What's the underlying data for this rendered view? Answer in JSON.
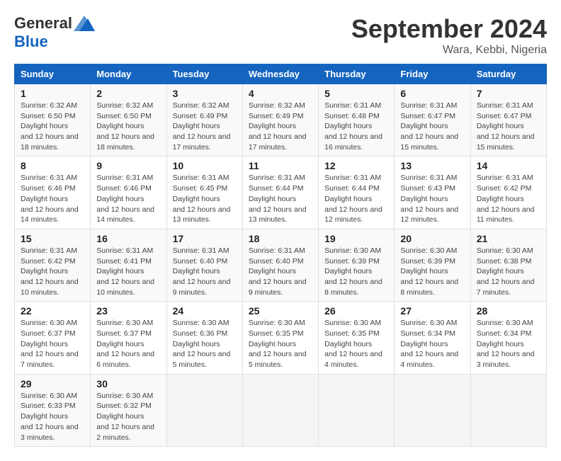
{
  "logo": {
    "general": "General",
    "blue": "Blue"
  },
  "title": {
    "month": "September 2024",
    "location": "Wara, Kebbi, Nigeria"
  },
  "columns": [
    "Sunday",
    "Monday",
    "Tuesday",
    "Wednesday",
    "Thursday",
    "Friday",
    "Saturday"
  ],
  "weeks": [
    [
      {
        "day": "1",
        "sunrise": "6:32 AM",
        "sunset": "6:50 PM",
        "daylight": "12 hours and 18 minutes."
      },
      {
        "day": "2",
        "sunrise": "6:32 AM",
        "sunset": "6:50 PM",
        "daylight": "12 hours and 18 minutes."
      },
      {
        "day": "3",
        "sunrise": "6:32 AM",
        "sunset": "6:49 PM",
        "daylight": "12 hours and 17 minutes."
      },
      {
        "day": "4",
        "sunrise": "6:32 AM",
        "sunset": "6:49 PM",
        "daylight": "12 hours and 17 minutes."
      },
      {
        "day": "5",
        "sunrise": "6:31 AM",
        "sunset": "6:48 PM",
        "daylight": "12 hours and 16 minutes."
      },
      {
        "day": "6",
        "sunrise": "6:31 AM",
        "sunset": "6:47 PM",
        "daylight": "12 hours and 15 minutes."
      },
      {
        "day": "7",
        "sunrise": "6:31 AM",
        "sunset": "6:47 PM",
        "daylight": "12 hours and 15 minutes."
      }
    ],
    [
      {
        "day": "8",
        "sunrise": "6:31 AM",
        "sunset": "6:46 PM",
        "daylight": "12 hours and 14 minutes."
      },
      {
        "day": "9",
        "sunrise": "6:31 AM",
        "sunset": "6:46 PM",
        "daylight": "12 hours and 14 minutes."
      },
      {
        "day": "10",
        "sunrise": "6:31 AM",
        "sunset": "6:45 PM",
        "daylight": "12 hours and 13 minutes."
      },
      {
        "day": "11",
        "sunrise": "6:31 AM",
        "sunset": "6:44 PM",
        "daylight": "12 hours and 13 minutes."
      },
      {
        "day": "12",
        "sunrise": "6:31 AM",
        "sunset": "6:44 PM",
        "daylight": "12 hours and 12 minutes."
      },
      {
        "day": "13",
        "sunrise": "6:31 AM",
        "sunset": "6:43 PM",
        "daylight": "12 hours and 12 minutes."
      },
      {
        "day": "14",
        "sunrise": "6:31 AM",
        "sunset": "6:42 PM",
        "daylight": "12 hours and 11 minutes."
      }
    ],
    [
      {
        "day": "15",
        "sunrise": "6:31 AM",
        "sunset": "6:42 PM",
        "daylight": "12 hours and 10 minutes."
      },
      {
        "day": "16",
        "sunrise": "6:31 AM",
        "sunset": "6:41 PM",
        "daylight": "12 hours and 10 minutes."
      },
      {
        "day": "17",
        "sunrise": "6:31 AM",
        "sunset": "6:40 PM",
        "daylight": "12 hours and 9 minutes."
      },
      {
        "day": "18",
        "sunrise": "6:31 AM",
        "sunset": "6:40 PM",
        "daylight": "12 hours and 9 minutes."
      },
      {
        "day": "19",
        "sunrise": "6:30 AM",
        "sunset": "6:39 PM",
        "daylight": "12 hours and 8 minutes."
      },
      {
        "day": "20",
        "sunrise": "6:30 AM",
        "sunset": "6:39 PM",
        "daylight": "12 hours and 8 minutes."
      },
      {
        "day": "21",
        "sunrise": "6:30 AM",
        "sunset": "6:38 PM",
        "daylight": "12 hours and 7 minutes."
      }
    ],
    [
      {
        "day": "22",
        "sunrise": "6:30 AM",
        "sunset": "6:37 PM",
        "daylight": "12 hours and 7 minutes."
      },
      {
        "day": "23",
        "sunrise": "6:30 AM",
        "sunset": "6:37 PM",
        "daylight": "12 hours and 6 minutes."
      },
      {
        "day": "24",
        "sunrise": "6:30 AM",
        "sunset": "6:36 PM",
        "daylight": "12 hours and 5 minutes."
      },
      {
        "day": "25",
        "sunrise": "6:30 AM",
        "sunset": "6:35 PM",
        "daylight": "12 hours and 5 minutes."
      },
      {
        "day": "26",
        "sunrise": "6:30 AM",
        "sunset": "6:35 PM",
        "daylight": "12 hours and 4 minutes."
      },
      {
        "day": "27",
        "sunrise": "6:30 AM",
        "sunset": "6:34 PM",
        "daylight": "12 hours and 4 minutes."
      },
      {
        "day": "28",
        "sunrise": "6:30 AM",
        "sunset": "6:34 PM",
        "daylight": "12 hours and 3 minutes."
      }
    ],
    [
      {
        "day": "29",
        "sunrise": "6:30 AM",
        "sunset": "6:33 PM",
        "daylight": "12 hours and 3 minutes."
      },
      {
        "day": "30",
        "sunrise": "6:30 AM",
        "sunset": "6:32 PM",
        "daylight": "12 hours and 2 minutes."
      },
      null,
      null,
      null,
      null,
      null
    ]
  ]
}
